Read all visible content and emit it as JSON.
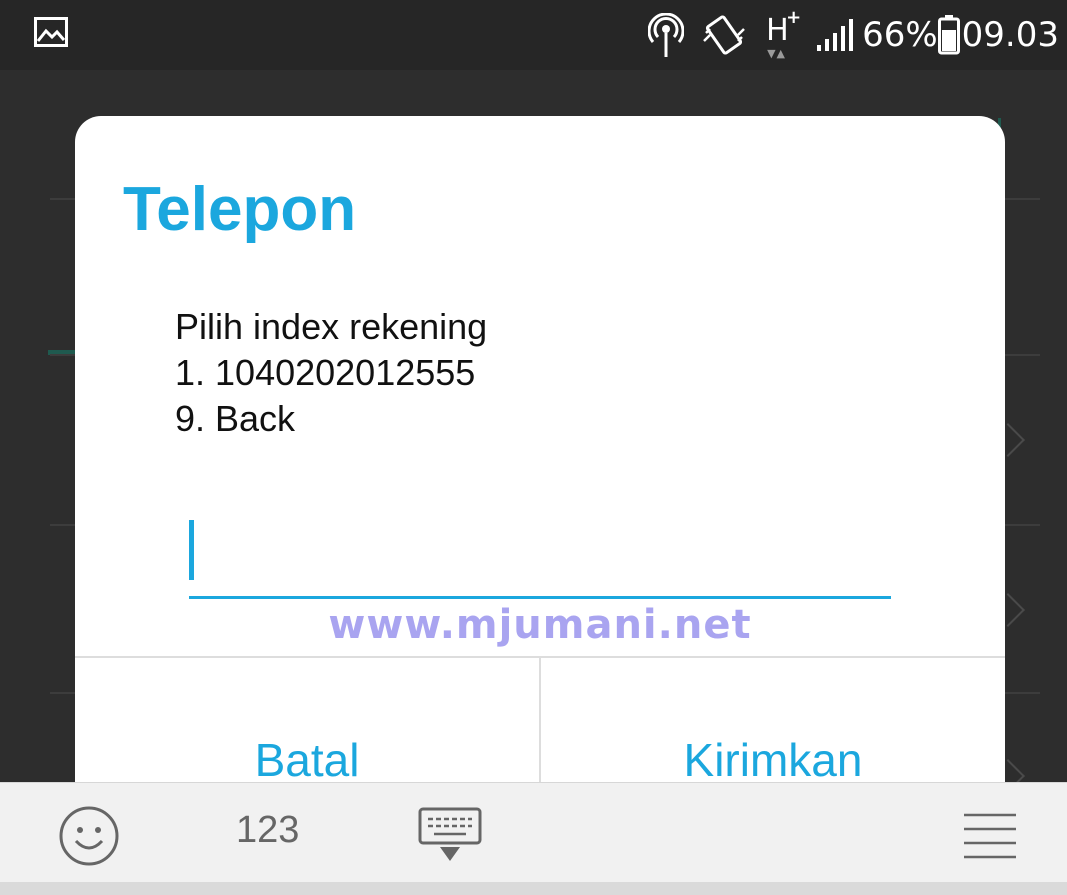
{
  "status_bar": {
    "battery_percent": "66%",
    "time": "09.03",
    "network_type": "H",
    "network_plus": "+",
    "icons": [
      "gallery-icon",
      "hotspot-icon",
      "vibrate-icon",
      "network-h-plus-icon",
      "signal-icon",
      "battery-icon"
    ]
  },
  "dialog": {
    "title": "Telepon",
    "message_lines": [
      "Pilih index rekening",
      "1. 1040202012555",
      "9. Back"
    ],
    "input_value": "",
    "cancel_label": "Batal",
    "send_label": "Kirimkan"
  },
  "watermark": "www.mjumani.net",
  "keyboard_toolbar": {
    "numbers_label": "123",
    "icons": [
      "emoji-icon",
      "hide-keyboard-icon",
      "menu-icon"
    ]
  },
  "colors": {
    "accent": "#1ba7de",
    "watermark": "#a9a4f0",
    "status_bar_bg": "#262626",
    "keyboard_bg": "#f1f1f1"
  }
}
